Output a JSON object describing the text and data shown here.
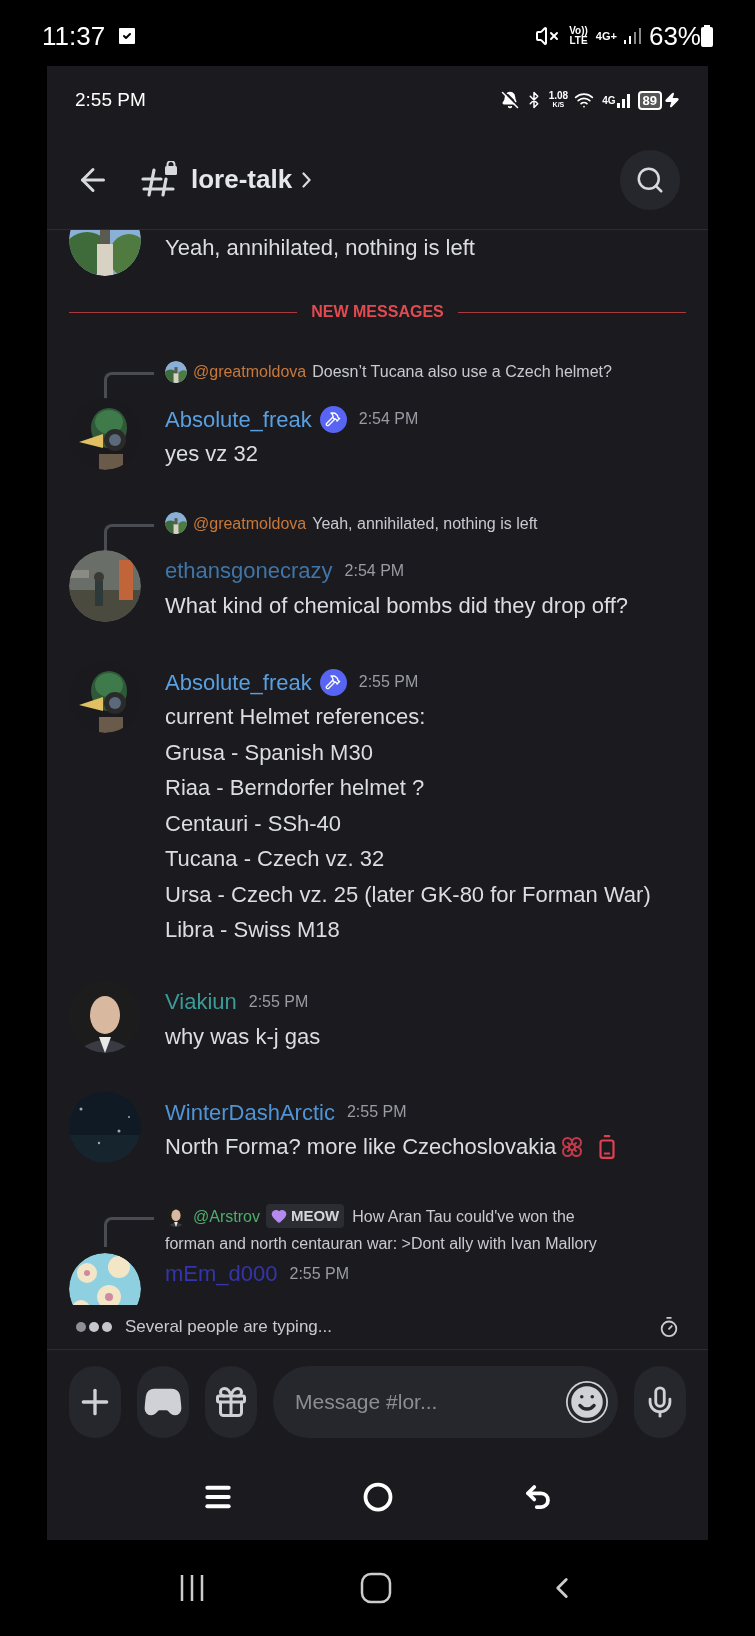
{
  "device_status": {
    "time": "11:37",
    "volte_top": "Vo))",
    "volte_bottom": "LTE",
    "network": "4G+",
    "battery": "63%"
  },
  "app_status": {
    "time": "2:55 PM",
    "speed": "1.08",
    "speed_unit": "K/S",
    "network": "4G",
    "battery": "89"
  },
  "header": {
    "channel": "lore-talk"
  },
  "prior_message": {
    "text": "Yeah, annihilated, nothing is left"
  },
  "divider": {
    "label": "NEW MESSAGES"
  },
  "messages": [
    {
      "kind": "text",
      "reply": {
        "author": "@greatmoldova",
        "color": "#c8793a",
        "lines": [
          "Doesn’t Tucana also use a Czech helmet?"
        ]
      },
      "author": "Absolute_freak",
      "color": "#5a9fe0",
      "badge": true,
      "time": "2:54 PM",
      "lines": [
        "yes vz 32"
      ]
    },
    {
      "kind": "text",
      "reply": {
        "author": "@greatmoldova",
        "color": "#c8793a",
        "lines": [
          "Yeah, annihilated, nothing is left"
        ]
      },
      "author": "ethansgonecrazy",
      "color": "#3f75a8",
      "badge": false,
      "time": "2:54 PM",
      "lines": [
        "What kind of chemical bombs did they drop off?"
      ]
    },
    {
      "kind": "text",
      "author": "Absolute_freak",
      "color": "#5a9fe0",
      "badge": true,
      "time": "2:55 PM",
      "lines": [
        "current Helmet references:",
        "Grusa - Spanish M30",
        "Riaa - Berndorfer helmet ?",
        "Centauri - SSh-40",
        "Tucana - Czech vz. 32",
        "Ursa - Czech vz. 25 (later GK-80 for Forman War)",
        "Libra - Swiss M18"
      ]
    },
    {
      "kind": "text",
      "author": "Viakiun",
      "color": "#3a9c98",
      "badge": false,
      "time": "2:55 PM",
      "lines": [
        "why was k-j gas"
      ]
    },
    {
      "kind": "emoji",
      "author": "WinterDashArctic",
      "color": "#4f94d4",
      "badge": false,
      "time": "2:55 PM",
      "lines": [
        "North Forma? more like Czechoslovakia"
      ]
    },
    {
      "kind": "text",
      "reply": {
        "author": "@Arstrov",
        "color": "#4caf6a",
        "tag": "MEOW",
        "lines": [
          "How Aran Tau could've won the",
          "forman and north centauran war: >Dont ally with Ivan Mallory"
        ]
      },
      "author": "mEm_d000",
      "color": "#3434ac",
      "badge": false,
      "time": "2:55 PM"
    }
  ],
  "typing": {
    "text": "Several people are typing..."
  },
  "composer": {
    "placeholder": "Message #lor..."
  }
}
